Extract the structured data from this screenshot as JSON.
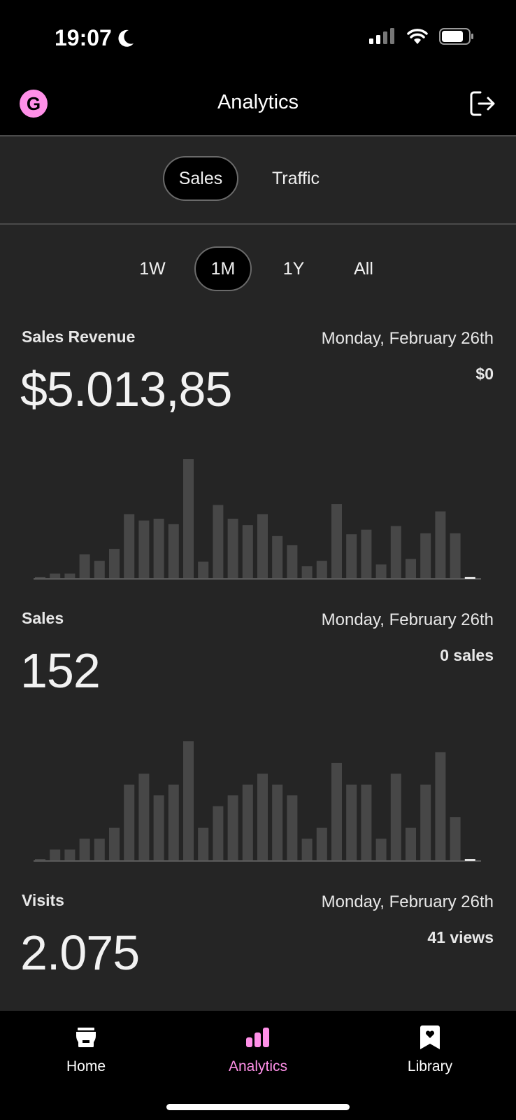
{
  "status_bar": {
    "time": "19:07"
  },
  "header": {
    "title": "Analytics",
    "logo_letter": "G"
  },
  "view_tabs": [
    {
      "label": "Sales",
      "active": true
    },
    {
      "label": "Traffic",
      "active": false
    }
  ],
  "range_tabs": [
    {
      "label": "1W",
      "active": false
    },
    {
      "label": "1M",
      "active": true
    },
    {
      "label": "1Y",
      "active": false
    },
    {
      "label": "All",
      "active": false
    }
  ],
  "metrics": {
    "revenue": {
      "label": "Sales Revenue",
      "date": "Monday, February 26th",
      "value": "$5.013,85",
      "selected_value": "$0"
    },
    "sales": {
      "label": "Sales",
      "date": "Monday, February 26th",
      "value": "152",
      "selected_value": "0 sales"
    },
    "visits": {
      "label": "Visits",
      "date": "Monday, February 26th",
      "value": "2.075",
      "selected_value": "41 views"
    }
  },
  "chart_data": [
    {
      "type": "bar",
      "values": [
        0.5,
        2.5,
        2.5,
        13,
        9.5,
        16,
        35,
        31.5,
        32.5,
        29.5,
        65,
        9,
        40,
        32.5,
        29,
        35,
        23,
        18,
        6.5,
        9.5,
        40.5,
        24,
        26.5,
        7.5,
        28.5,
        10.5,
        24.5,
        36.5,
        24.5,
        0
      ],
      "ylim": [
        0,
        65
      ]
    },
    {
      "type": "bar",
      "values": [
        0,
        1,
        1,
        2,
        2,
        3,
        7,
        8,
        6,
        7,
        11,
        3,
        5,
        6,
        7,
        8,
        7,
        6,
        2,
        3,
        9,
        7,
        7,
        2,
        8,
        3,
        7,
        10,
        4,
        0
      ],
      "ylim": [
        0,
        11
      ]
    }
  ],
  "tab_bar": [
    {
      "label": "Home",
      "icon": "store-icon",
      "active": false
    },
    {
      "label": "Analytics",
      "icon": "bar-chart-icon",
      "active": true
    },
    {
      "label": "Library",
      "icon": "bookmark-icon",
      "active": false
    }
  ],
  "colors": {
    "accent": "#ff90e8",
    "bar": "#474747",
    "background": "#252525"
  }
}
